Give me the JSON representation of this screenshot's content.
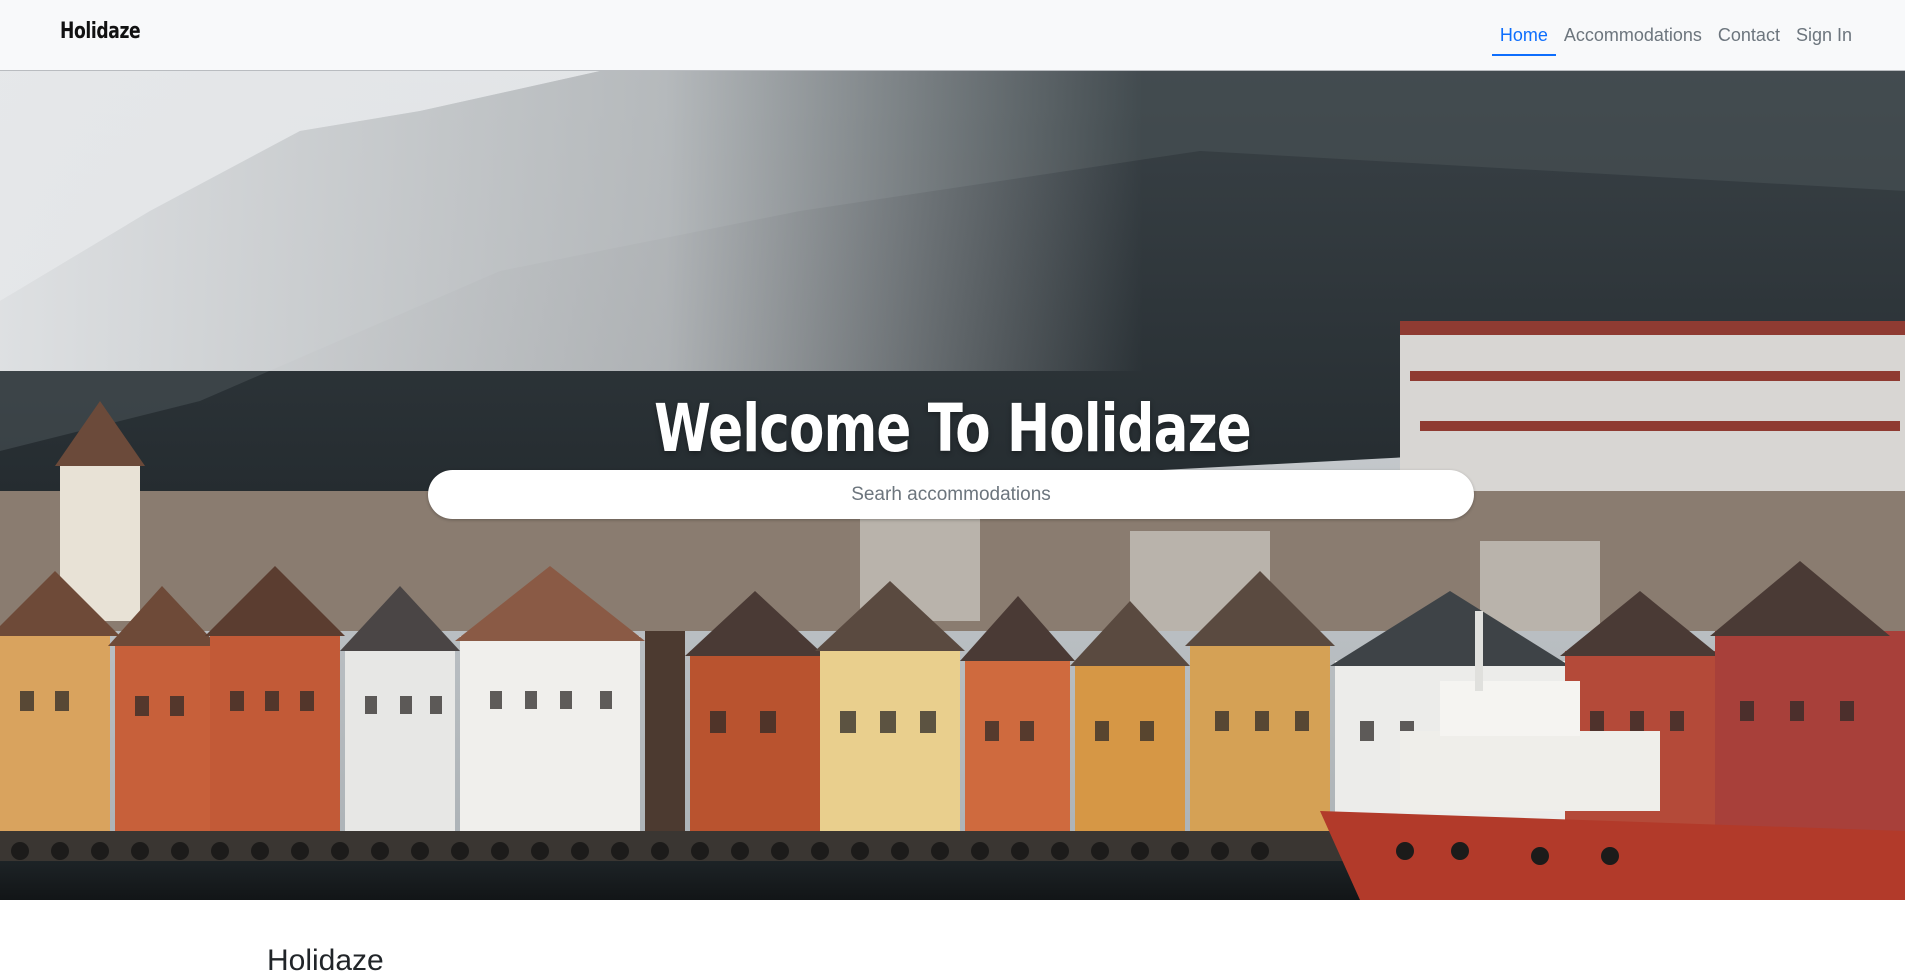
{
  "navbar": {
    "brand": "Holidaze",
    "links": [
      {
        "label": "Home",
        "active": true
      },
      {
        "label": "Accommodations",
        "active": false
      },
      {
        "label": "Contact",
        "active": false
      },
      {
        "label": "Sign In",
        "active": false
      }
    ],
    "active_color": "#0d6efd",
    "link_color": "#6c757d"
  },
  "hero": {
    "title": "Welcome To Holidaze",
    "search_placeholder": "Searh accommodations",
    "image": "harbour-town-photo"
  },
  "section": {
    "title": "Holidaze"
  }
}
